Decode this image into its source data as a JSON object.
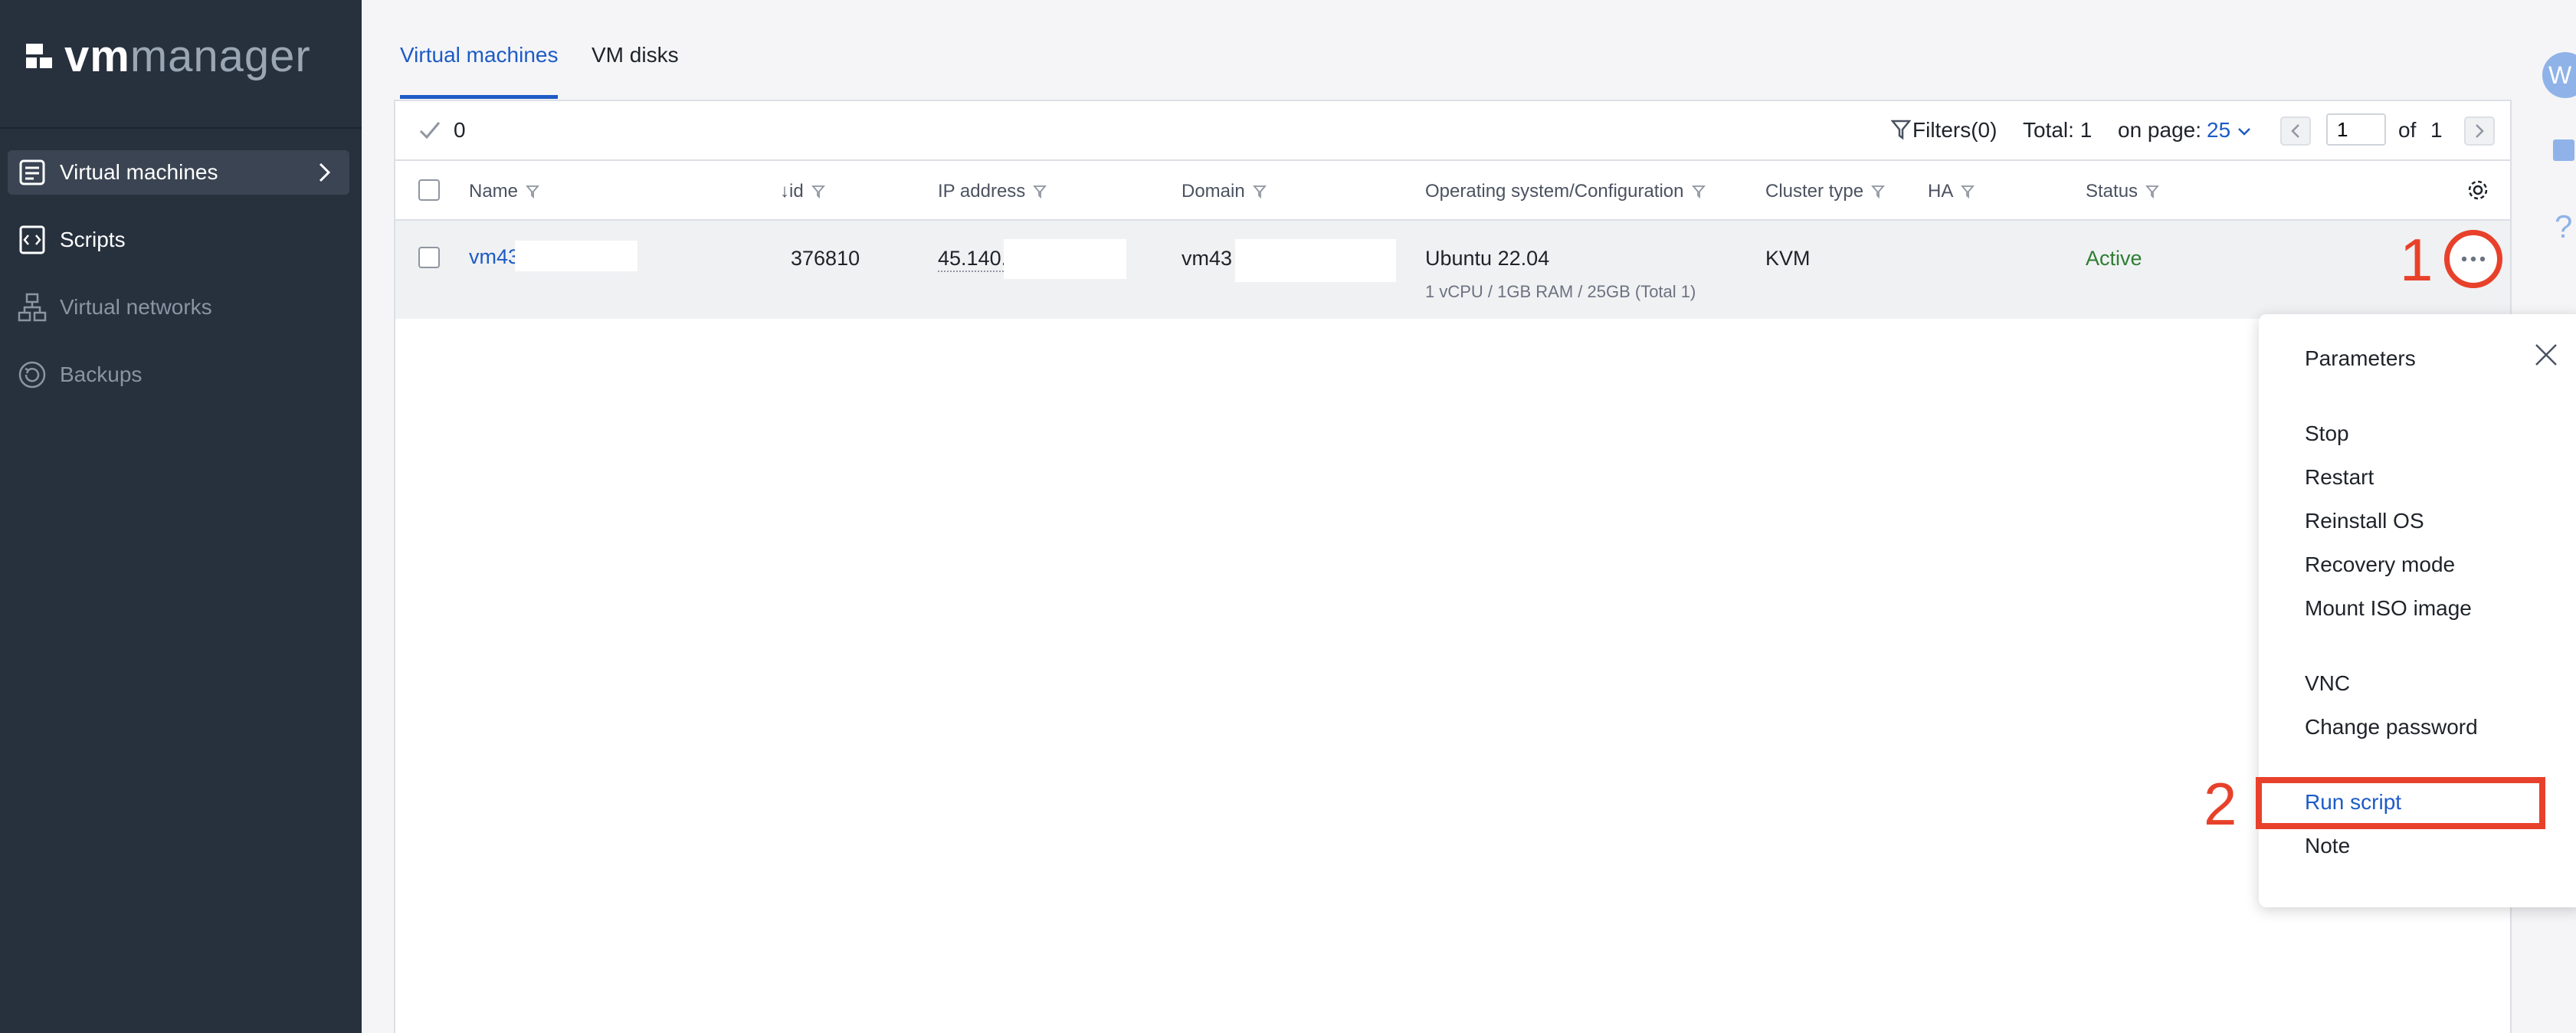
{
  "app": {
    "logo_bold": "vm",
    "logo_light": "manager"
  },
  "sidebar": {
    "items": [
      {
        "label": "Virtual machines",
        "icon": "vm-list-icon",
        "active": true
      },
      {
        "label": "Scripts",
        "icon": "script-icon"
      },
      {
        "label": "Virtual networks",
        "icon": "network-icon",
        "disabled": true
      },
      {
        "label": "Backups",
        "icon": "backup-icon"
      }
    ]
  },
  "tabs": [
    {
      "label": "Virtual machines",
      "active": true
    },
    {
      "label": "VM disks"
    }
  ],
  "toolbar": {
    "selected_count": "0",
    "filters_label": "Filters(0)",
    "total_label": "Total: 1",
    "on_page_label": "on page:",
    "on_page_value": "25",
    "page_value": "1",
    "of_label": "of",
    "total_pages": "1"
  },
  "table": {
    "columns": [
      "Name",
      "id",
      "IP address",
      "Domain",
      "Operating system/Configuration",
      "Cluster type",
      "HA",
      "Status"
    ],
    "sort_indicator": "↓",
    "rows": [
      {
        "name": "vm43",
        "id": "376810",
        "ip": "45.140.",
        "domain": "vm43",
        "os": "Ubuntu 22.04",
        "config": "1 vCPU / 1GB RAM / 25GB (Total 1)",
        "cluster": "KVM",
        "ha": "",
        "status": "Active"
      }
    ]
  },
  "context_menu": {
    "items": [
      "Parameters",
      "Stop",
      "Restart",
      "Reinstall OS",
      "Recovery mode",
      "Mount ISO image",
      "VNC",
      "Change password",
      "Run script",
      "Note"
    ]
  },
  "annotations": {
    "step1": "1",
    "step2": "2"
  },
  "user": {
    "avatar_initial": "W"
  },
  "colors": {
    "accent": "#1d5bc6",
    "sidebar": "#27303d",
    "active_status": "#2e7d32",
    "annotation": "#e8412b"
  }
}
